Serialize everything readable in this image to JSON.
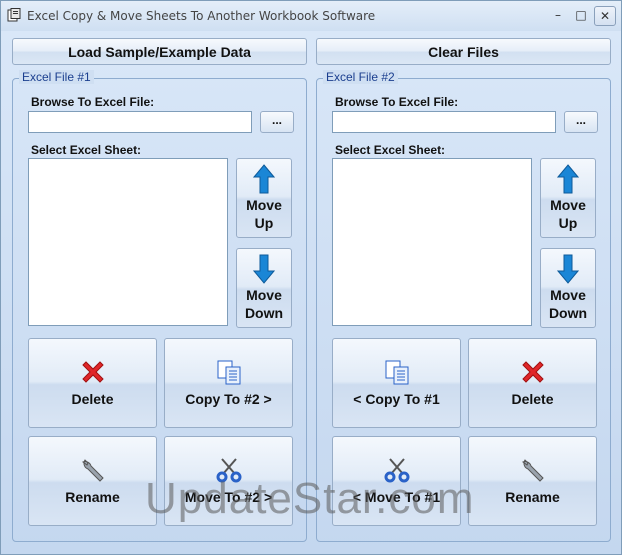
{
  "window": {
    "title": "Excel Copy & Move Sheets To Another Workbook Software",
    "minimize_label": "–",
    "maximize_label": "□",
    "close_label": "✕"
  },
  "toolbar": {
    "load_sample_label": "Load Sample/Example Data",
    "clear_files_label": "Clear Files"
  },
  "file1": {
    "group_title": "Excel File #1",
    "browse_label": "Browse To Excel File:",
    "browse_value": "",
    "browse_button": "...",
    "select_sheet_label": "Select Excel Sheet:",
    "move_up_line1": "Move",
    "move_up_line2": "Up",
    "move_down_line1": "Move",
    "move_down_line2": "Down",
    "delete_label": "Delete",
    "copy_label": "Copy To #2 >",
    "rename_label": "Rename",
    "move_label": "Move To #2 >"
  },
  "file2": {
    "group_title": "Excel File #2",
    "browse_label": "Browse To Excel File:",
    "browse_value": "",
    "browse_button": "...",
    "select_sheet_label": "Select Excel Sheet:",
    "move_up_line1": "Move",
    "move_up_line2": "Up",
    "move_down_line1": "Move",
    "move_down_line2": "Down",
    "copy_label": "< Copy To #1",
    "delete_label": "Delete",
    "move_label": "< Move To #1",
    "rename_label": "Rename"
  },
  "watermark": "UpdateStar.com",
  "colors": {
    "group_title": "#1b3f8f",
    "arrow_blue": "#1a86d6",
    "delete_red": "#e0262a",
    "scissors_blue": "#2a62c8"
  }
}
